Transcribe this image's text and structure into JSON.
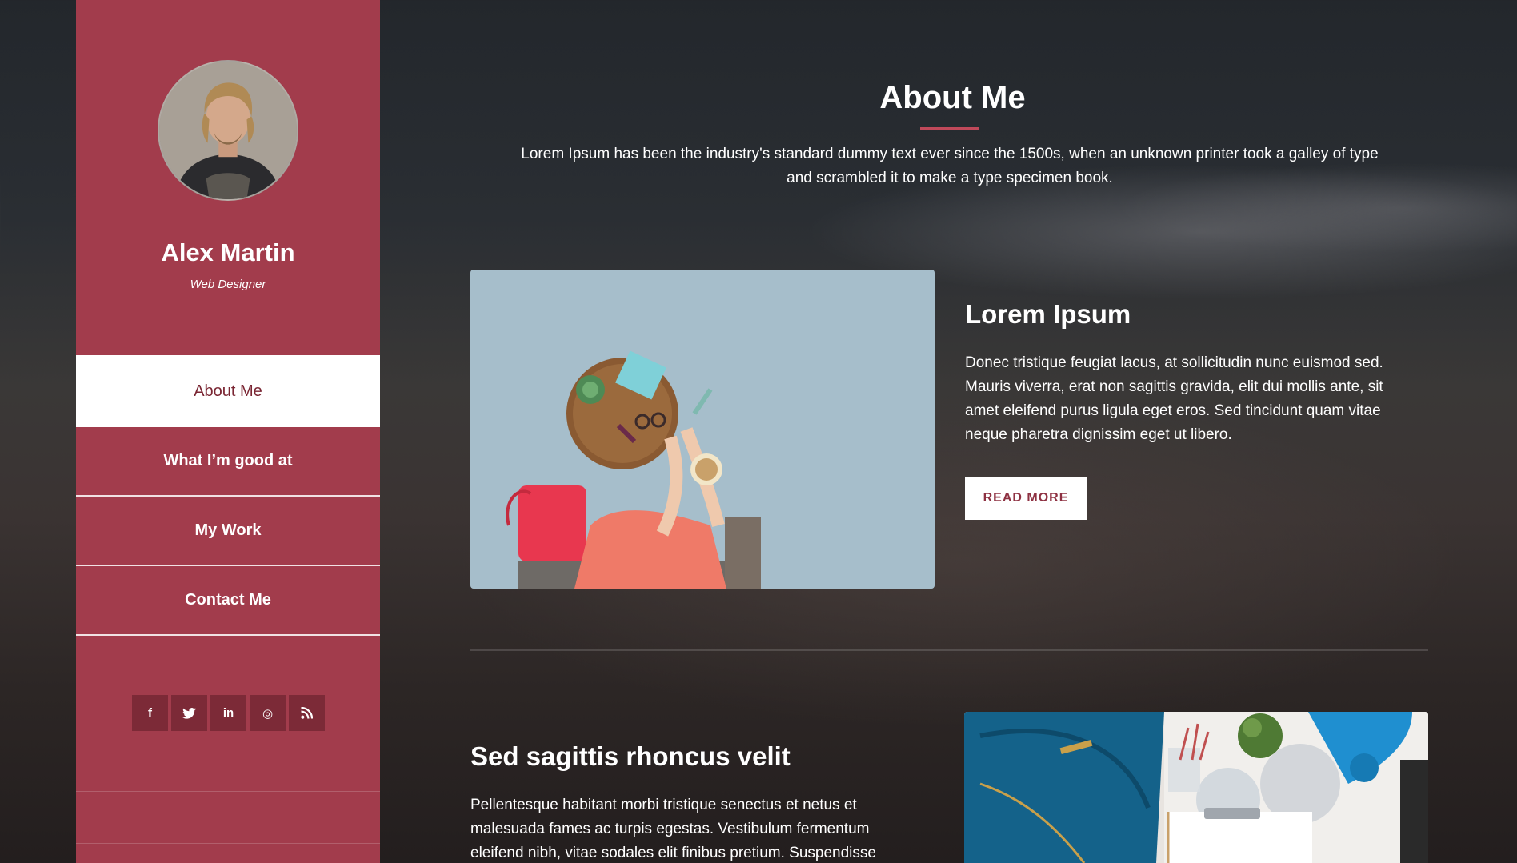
{
  "profile": {
    "name": "Alex Martin",
    "role": "Web Designer"
  },
  "nav": {
    "items": [
      {
        "label": "About Me",
        "active": true
      },
      {
        "label": "What I’m good at",
        "active": false
      },
      {
        "label": "My Work",
        "active": false
      },
      {
        "label": "Contact Me",
        "active": false
      }
    ]
  },
  "social": {
    "icons": [
      {
        "name": "facebook-icon",
        "glyph": "f"
      },
      {
        "name": "twitter-icon",
        "glyph": "t"
      },
      {
        "name": "linkedin-icon",
        "glyph": "in"
      },
      {
        "name": "dribbble-icon",
        "glyph": "◎"
      },
      {
        "name": "rss-icon",
        "glyph": "≋"
      }
    ]
  },
  "section": {
    "title": "About Me",
    "intro": "Lorem Ipsum has been the industry's standard dummy text ever since the 1500s, when an unknown printer took a galley of type and scrambled it to make a type specimen book."
  },
  "cards": [
    {
      "title": "Lorem Ipsum",
      "text": "Donec tristique feugiat lacus, at sollicitudin nunc euismod sed. Mauris viverra, erat non sagittis gravida, elit dui mollis ante, sit amet eleifend purus ligula eget eros. Sed tincidunt quam vitae neque pharetra dignissim eget ut libero.",
      "button": "READ MORE"
    },
    {
      "title": "Sed sagittis rhoncus velit",
      "text": "Pellentesque habitant morbi tristique senectus et netus et malesuada fames ac turpis egestas. Vestibulum fermentum eleifend nibh, vitae sodales elit finibus pretium. Suspendisse"
    }
  ],
  "colors": {
    "sidebar": "#a23c4c",
    "accent": "#c0495a",
    "button_text": "#8e3142"
  }
}
